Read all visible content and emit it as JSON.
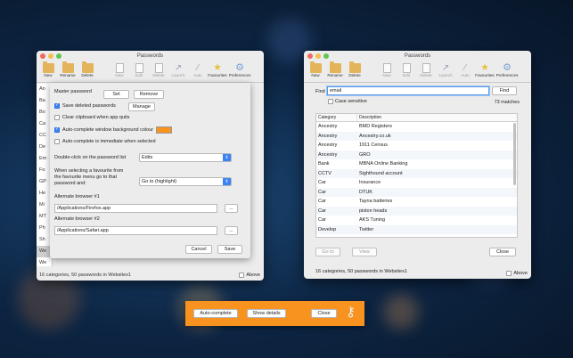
{
  "left_window": {
    "title": "Passwords",
    "toolbar": [
      {
        "label": "New",
        "icon": "folder-icon"
      },
      {
        "label": "Rename",
        "icon": "folder-icon"
      },
      {
        "label": "Delete",
        "icon": "folder-delete-icon"
      },
      {
        "label": "New",
        "icon": "document-icon"
      },
      {
        "label": "Edit",
        "icon": "document-icon"
      },
      {
        "label": "Delete",
        "icon": "document-delete-icon"
      },
      {
        "label": "Launch",
        "icon": "launch-icon"
      },
      {
        "label": "Auto",
        "icon": "wand-icon"
      },
      {
        "label": "Favourites",
        "icon": "star-icon"
      },
      {
        "label": "Preferences",
        "icon": "gear-icon"
      }
    ],
    "categories": [
      "An",
      "Ba",
      "Bo",
      "Ca",
      "CC",
      "De",
      "Em",
      "Fo",
      "GP",
      "He",
      "Mi",
      "MT",
      "Ph",
      "Sh",
      "We",
      "We"
    ],
    "status": "16 categories, 50 passwords in Websites1",
    "above_label": "Above"
  },
  "preferences": {
    "master_password_label": "Master password",
    "set_label": "Set",
    "remove_label": "Remove",
    "save_deleted_label": "Save deleted passwords",
    "manage_label": "Manage",
    "clear_clipboard_label": "Clear clipboard when app quits",
    "auto_complete_colour_label": "Auto-complete window background colour",
    "auto_complete_immediate_label": "Auto-complete is immediate when selected",
    "double_click_label": "Double-click on the password list",
    "double_click_value": "Edits",
    "favourite_label_1": "When selecting a favourite from",
    "favourite_label_2": "the favourite menu go to that",
    "favourite_label_3": "password and:",
    "favourite_value": "Go to (highlight)",
    "alt_browser_1_label": "Alternate browser #1",
    "alt_browser_1_value": "/Applications/Firefox.app",
    "alt_browser_2_label": "Alternate browser #2",
    "alt_browser_2_value": "/Applications/Safari.app",
    "browse_label": "...",
    "cancel_label": "Cancel",
    "save_label": "Save",
    "accent_colour": "#f7931e"
  },
  "right_window": {
    "title": "Passwords",
    "toolbar": [
      {
        "label": "New",
        "icon": "folder-icon"
      },
      {
        "label": "Rename",
        "icon": "folder-icon"
      },
      {
        "label": "Delete",
        "icon": "folder-delete-icon"
      },
      {
        "label": "New",
        "icon": "document-icon"
      },
      {
        "label": "Edit",
        "icon": "document-icon"
      },
      {
        "label": "Delete",
        "icon": "document-delete-icon"
      },
      {
        "label": "Launch",
        "icon": "launch-icon"
      },
      {
        "label": "Auto",
        "icon": "wand-icon"
      },
      {
        "label": "Favourites",
        "icon": "star-icon"
      },
      {
        "label": "Preferences",
        "icon": "gear-icon"
      }
    ],
    "find_label": "Find",
    "find_value": "email",
    "find_button": "Find",
    "case_sensitive_label": "Case sensitive",
    "matches": "73 matches",
    "columns": [
      "Category",
      "Description"
    ],
    "rows": [
      [
        "Ancestry",
        "BMD Registers"
      ],
      [
        "Ancestry",
        "Ancestry.co.uk"
      ],
      [
        "Ancestry",
        "1911 Census"
      ],
      [
        "Ancestry",
        "GRO"
      ],
      [
        "Bank",
        "MBNA Online Banking"
      ],
      [
        "CCTV",
        "Sighthound account"
      ],
      [
        "Car",
        "Insurance"
      ],
      [
        "Car",
        "DTUK"
      ],
      [
        "Car",
        "Tayna batteries"
      ],
      [
        "Car",
        "piston heads"
      ],
      [
        "Car",
        "AKS Tuning"
      ],
      [
        "Develop",
        "Twitter"
      ]
    ],
    "go_to_label": "Go to",
    "view_label": "View",
    "close_label": "Close",
    "status": "16 categories, 50 passwords in Websites1",
    "above_label": "Above"
  },
  "autocomplete_bar": {
    "auto_complete_label": "Auto-complete",
    "show_details_label": "Show details",
    "close_label": "Close",
    "icon": "key-icon",
    "background": "#f7931e"
  }
}
